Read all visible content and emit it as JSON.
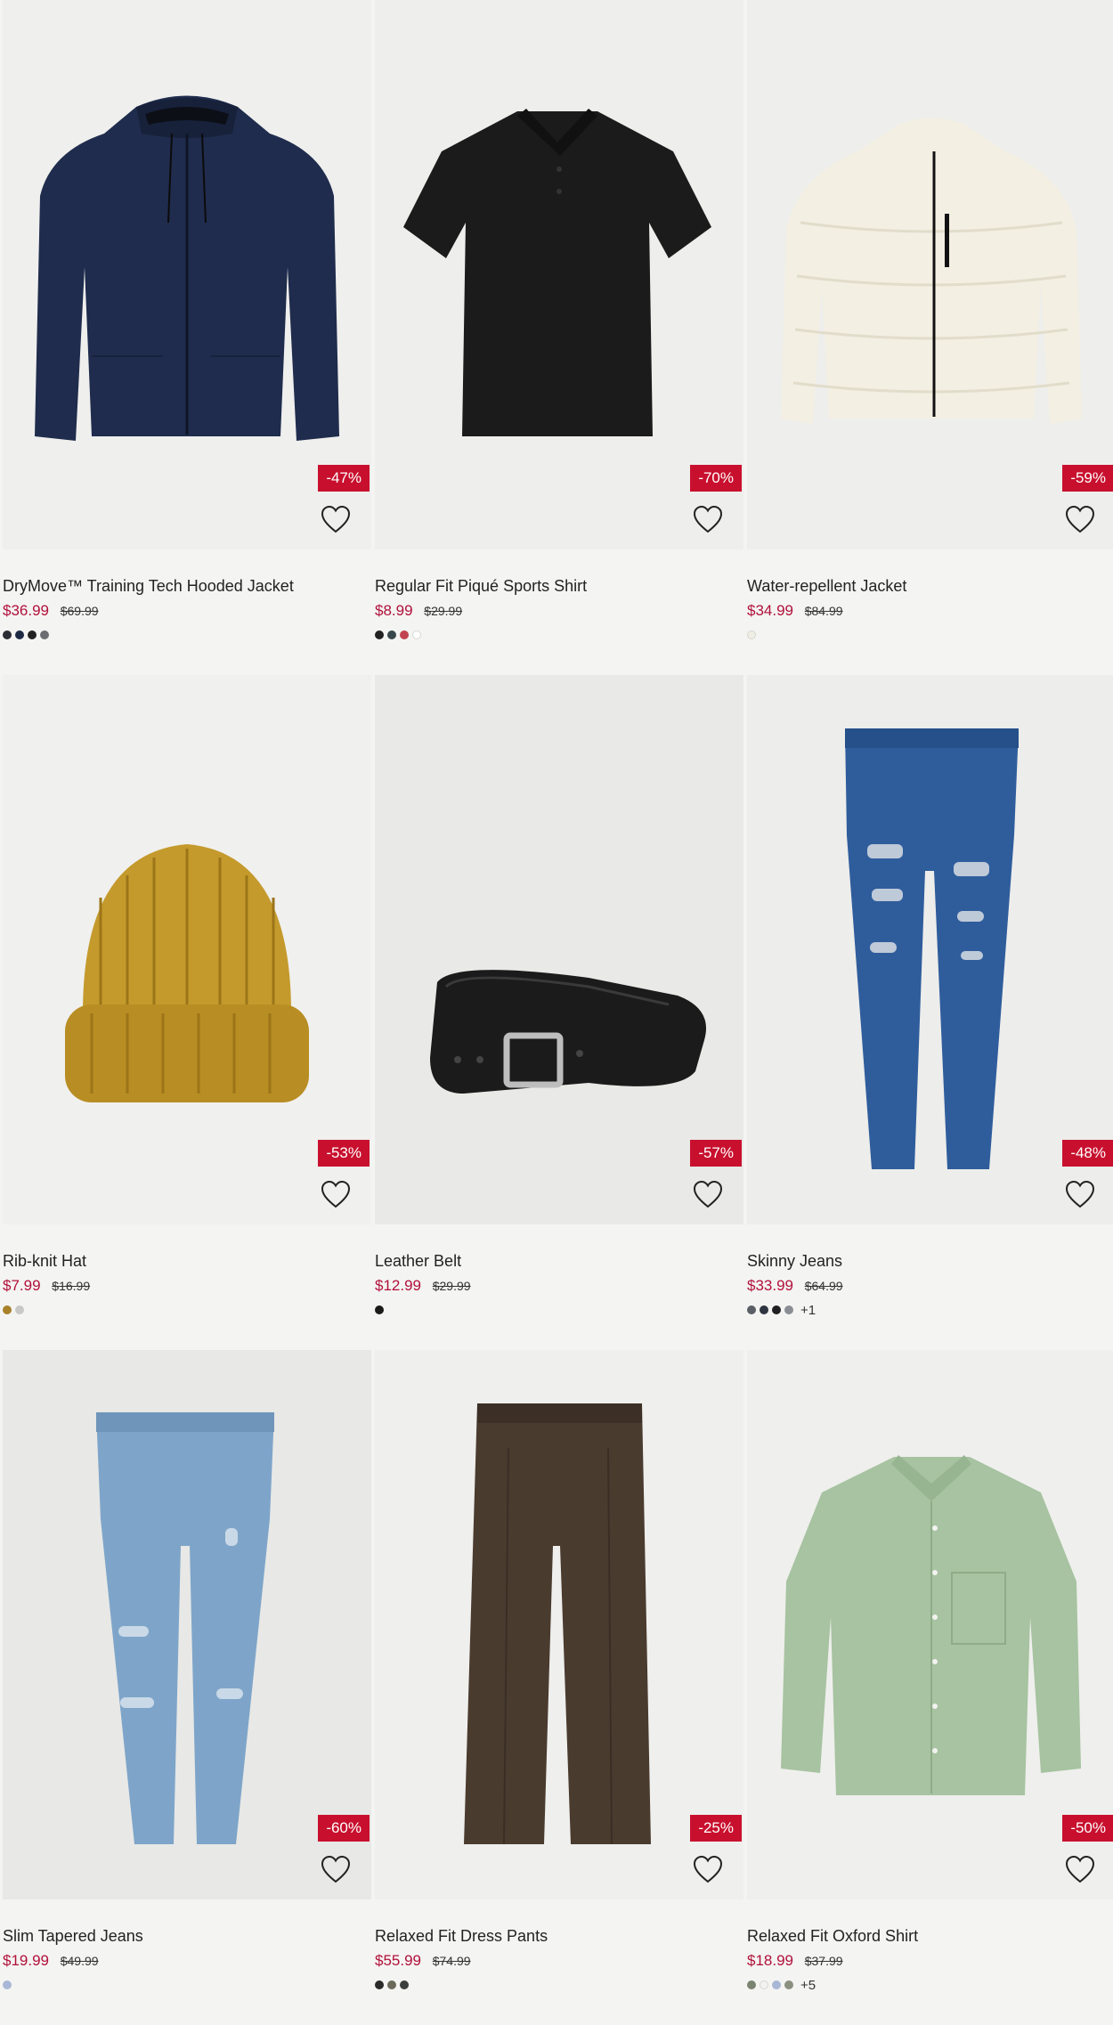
{
  "products": [
    {
      "name": "DryMove™ Training Tech Hooded Jacket",
      "price": "$36.99",
      "original": "$69.99",
      "discount": "-47%",
      "swatches": [
        "#2a2d33",
        "#1e2a44",
        "#222222",
        "#6b6d70"
      ],
      "more": "",
      "image": "navy-hooded-jacket",
      "bg": "#efefed"
    },
    {
      "name": "Regular Fit Piqué Sports Shirt",
      "price": "$8.99",
      "original": "$29.99",
      "discount": "-70%",
      "swatches": [
        "#222222",
        "#38474a",
        "#c0444f",
        "#ffffff"
      ],
      "more": "",
      "image": "black-polo-shirt",
      "bg": "#eeeeec"
    },
    {
      "name": "Water-repellent Jacket",
      "price": "$34.99",
      "original": "$84.99",
      "discount": "-59%",
      "swatches": [
        "#efeee4"
      ],
      "more": "",
      "image": "cream-puffer-jacket",
      "bg": "#eeeeec"
    },
    {
      "name": "Rib-knit Hat",
      "price": "$7.99",
      "original": "$16.99",
      "discount": "-53%",
      "swatches": [
        "#a8812a",
        "#c8c8c4"
      ],
      "more": "",
      "image": "mustard-beanie",
      "bg": "#f0f0ee"
    },
    {
      "name": "Leather Belt",
      "price": "$12.99",
      "original": "$29.99",
      "discount": "-57%",
      "swatches": [
        "#1a1a1a"
      ],
      "more": "",
      "image": "black-leather-belt",
      "bg": "#e9e9e7"
    },
    {
      "name": "Skinny Jeans",
      "price": "$33.99",
      "original": "$64.99",
      "discount": "-48%",
      "swatches": [
        "#5a5f66",
        "#2e3440",
        "#1f1f22",
        "#8a8e94"
      ],
      "more": "+1",
      "image": "blue-ripped-skinny-jeans",
      "bg": "#ededeb"
    },
    {
      "name": "Slim Tapered Jeans",
      "price": "$19.99",
      "original": "$49.99",
      "discount": "-60%",
      "swatches": [
        "#a9b7d6"
      ],
      "more": "",
      "image": "light-blue-tapered-jeans",
      "bg": "#e8e8e6"
    },
    {
      "name": "Relaxed Fit Dress Pants",
      "price": "$55.99",
      "original": "$74.99",
      "discount": "-25%",
      "swatches": [
        "#2a2a2a",
        "#6b6a5a",
        "#3c3f3e"
      ],
      "more": "",
      "image": "brown-dress-pants",
      "bg": "#efefed"
    },
    {
      "name": "Relaxed Fit Oxford Shirt",
      "price": "$18.99",
      "original": "$37.99",
      "discount": "-50%",
      "swatches": [
        "#7b8470",
        "#f2f2f0",
        "#a9b7d6",
        "#8a8f80"
      ],
      "more": "+5",
      "image": "sage-oxford-shirt",
      "bg": "#efefed"
    }
  ],
  "colors": {
    "sale": "#b1103a",
    "badge": "#c8102e",
    "page_bg": "#f4f4f2"
  },
  "icons": {
    "favorite": "heart-outline-icon"
  }
}
